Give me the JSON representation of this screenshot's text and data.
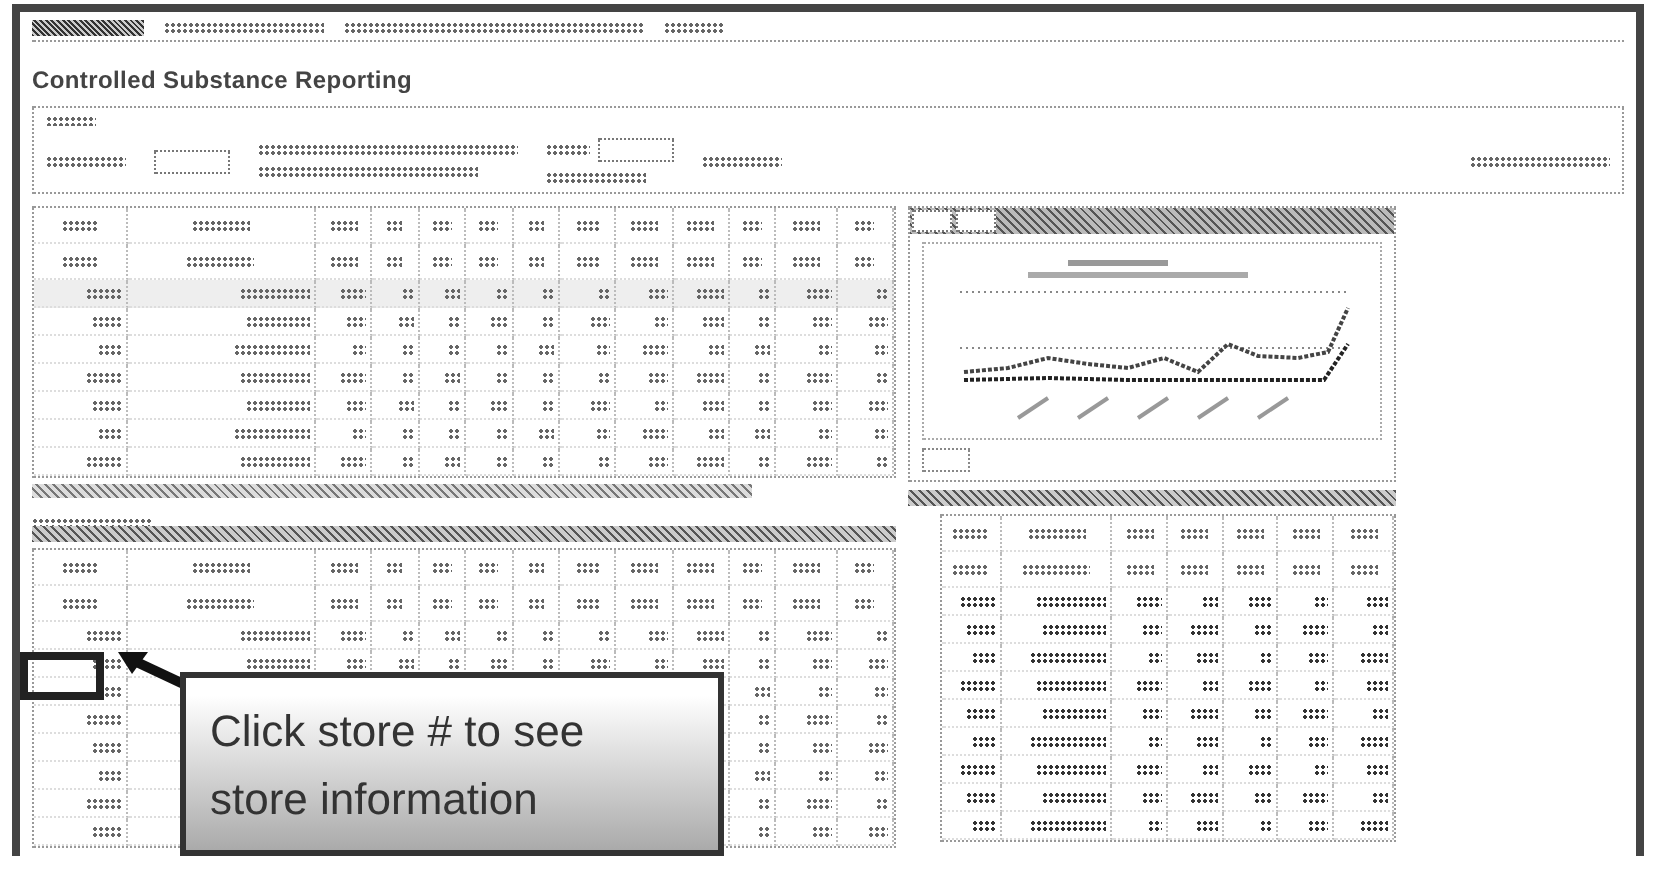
{
  "page": {
    "title": "Controlled Substance Reporting"
  },
  "callout": {
    "text": "Click store # to see store information"
  }
}
